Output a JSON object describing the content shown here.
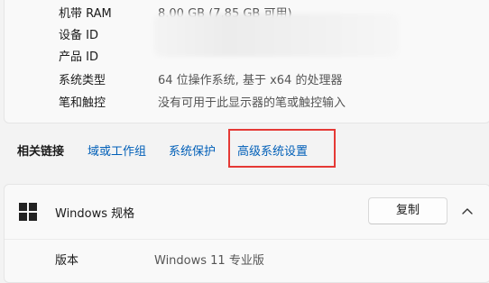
{
  "specs": [
    {
      "label": "机带 RAM",
      "value": "8.00 GB (7.85 GB 可用)"
    },
    {
      "label": "设备 ID",
      "value": ""
    },
    {
      "label": "产品 ID",
      "value": ""
    },
    {
      "label": "系统类型",
      "value": "64 位操作系统, 基于 x64 的处理器"
    },
    {
      "label": "笔和触控",
      "value": "没有可用于此显示器的笔或触控输入"
    }
  ],
  "related": {
    "title": "相关链接",
    "links": [
      "域或工作组",
      "系统保护",
      "高级系统设置"
    ]
  },
  "windows_spec": {
    "title": "Windows 规格",
    "copy_label": "复制",
    "rows": [
      {
        "label": "版本",
        "value": "Windows 11 专业版"
      }
    ]
  },
  "colors": {
    "link": "#005fb8",
    "highlight": "#e53935"
  }
}
